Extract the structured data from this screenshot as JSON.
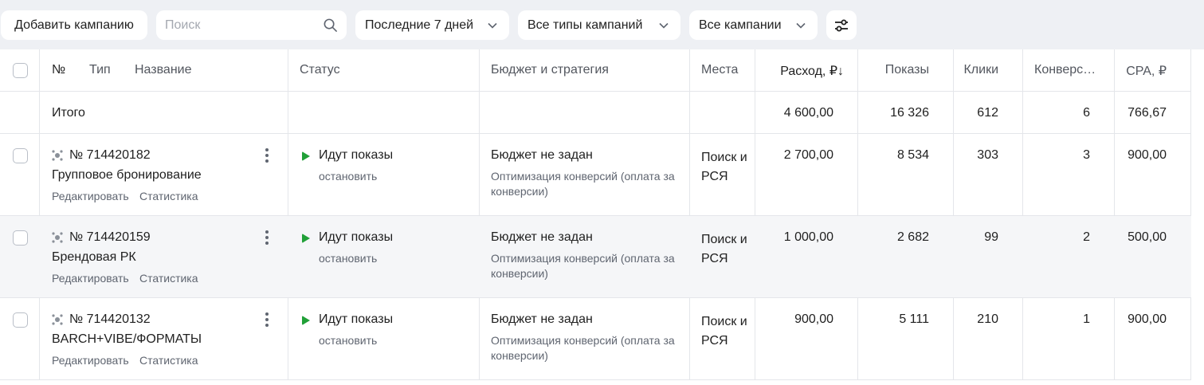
{
  "toolbar": {
    "add_campaign": "Добавить кампанию",
    "search_placeholder": "Поиск",
    "period": "Последние 7 дней",
    "types": "Все типы кампаний",
    "campaigns": "Все кампании"
  },
  "header": {
    "num": "№",
    "type": "Тип",
    "name": "Название",
    "status": "Статус",
    "budget": "Бюджет и стратегия",
    "places": "Места",
    "spend": "Расход, ₽↓",
    "impressions": "Показы",
    "clicks": "Клики",
    "conversions": "Конверс…",
    "cpa": "CPA, ₽"
  },
  "total": {
    "label": "Итого",
    "spend": "4 600,00",
    "impressions": "16 326",
    "clicks": "612",
    "conversions": "6",
    "cpa": "766,67"
  },
  "rows": [
    {
      "id": "№ 714420182",
      "name": "Групповое бронирование",
      "edit": "Редактировать",
      "stats": "Статистика",
      "status": "Идут показы",
      "stop": "остановить",
      "budget": "Бюджет не задан",
      "strategy": "Оптимизация конверсий (оплата за конверсии)",
      "places": "Поиск и РСЯ",
      "spend": "2 700,00",
      "impressions": "8 534",
      "clicks": "303",
      "conversions": "3",
      "cpa": "900,00"
    },
    {
      "id": "№ 714420159",
      "name": "Брендовая РК",
      "edit": "Редактировать",
      "stats": "Статистика",
      "status": "Идут показы",
      "stop": "остановить",
      "budget": "Бюджет не задан",
      "strategy": "Оптимизация конверсий (оплата за конверсии)",
      "places": "Поиск и РСЯ",
      "spend": "1 000,00",
      "impressions": "2 682",
      "clicks": "99",
      "conversions": "2",
      "cpa": "500,00"
    },
    {
      "id": "№ 714420132",
      "name": "BARCH+VIBE/ФОРМАТЫ",
      "edit": "Редактировать",
      "stats": "Статистика",
      "status": "Идут показы",
      "stop": "остановить",
      "budget": "Бюджет не задан",
      "strategy": "Оптимизация конверсий (оплата за конверсии)",
      "places": "Поиск и РСЯ",
      "spend": "900,00",
      "impressions": "5 111",
      "clicks": "210",
      "conversions": "1",
      "cpa": "900,00"
    }
  ],
  "colors": {
    "status_green": "#21a038",
    "background": "#eef0f4"
  },
  "icons": {
    "search": "search-icon",
    "chevron": "chevron-down-icon",
    "filter": "sliders-icon",
    "campaign": "campaign-type-icon",
    "menu": "more-vertical-icon",
    "play": "play-icon"
  }
}
